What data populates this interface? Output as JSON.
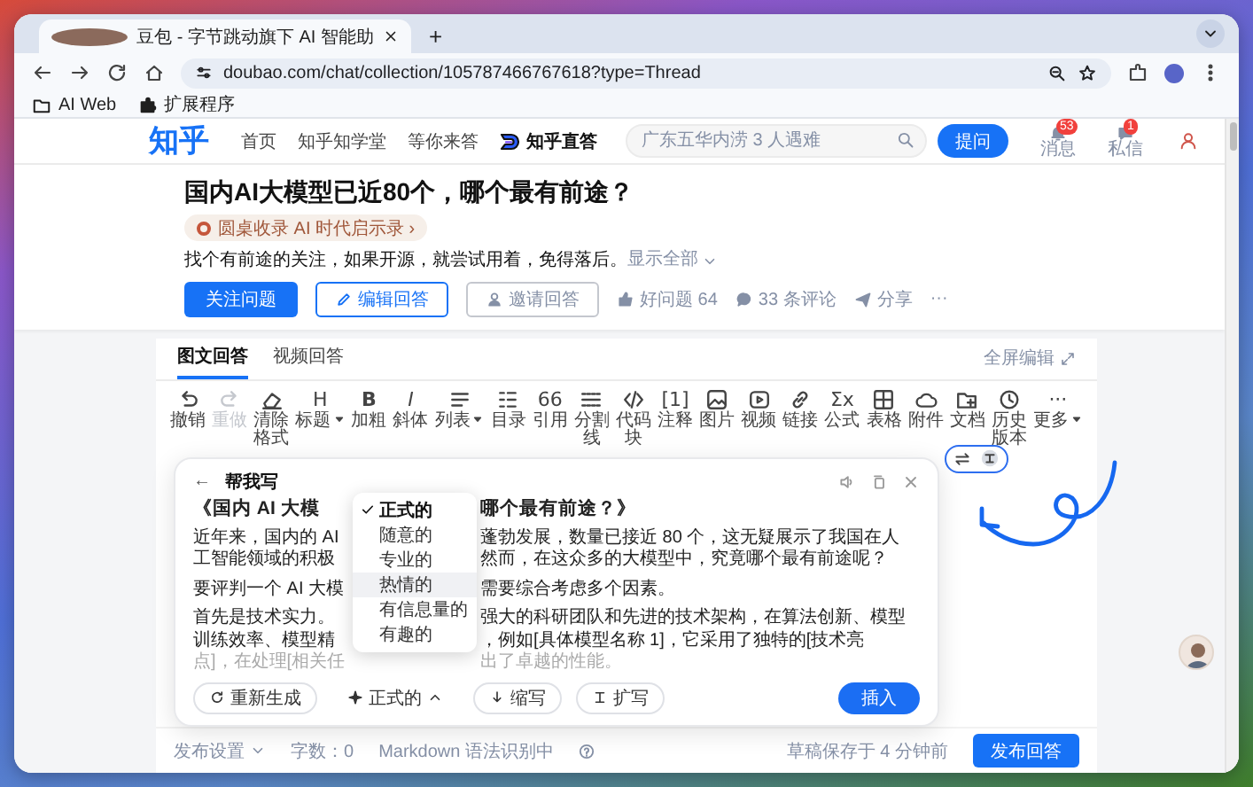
{
  "browser": {
    "tab": {
      "title": "豆包 - 字节跳动旗下 AI 智能助"
    },
    "new_tab": "+",
    "url": "doubao.com/chat/collection/105787466767618?type=Thread",
    "bookmarks": [
      {
        "label": "AI Web",
        "kind": "folder"
      },
      {
        "label": "扩展程序",
        "kind": "puzzle"
      }
    ]
  },
  "header": {
    "logo": "知乎",
    "nav": [
      {
        "label": "首页",
        "kind": "link"
      },
      {
        "label": "知乎知学堂",
        "kind": "link"
      },
      {
        "label": "等你来答",
        "kind": "link"
      },
      {
        "label": "知乎直答",
        "kind": "brand"
      }
    ],
    "search": {
      "placeholder": "广东五华内涝 3 人遇难"
    },
    "ask_button": "提问",
    "icons": [
      {
        "label": "消息",
        "badge": "53",
        "kind": "bell"
      },
      {
        "label": "私信",
        "badge": "1",
        "kind": "mail"
      }
    ]
  },
  "question": {
    "title": "国内AI大模型已近80个，哪个最有前途？",
    "tag": "圆桌收录 AI 时代启示录",
    "tag_arrow": "›",
    "description": "找个有前途的关注，如果开源，就尝试用着，免得落后。",
    "show_all": "显示全部",
    "actions": [
      {
        "label": "关注问题",
        "kind": "primary"
      },
      {
        "label": "编辑回答",
        "kind": "edit"
      },
      {
        "label": "邀请回答",
        "kind": "invite"
      },
      {
        "label": "好问题 64",
        "kind": "vote"
      },
      {
        "label": "33 条评论",
        "kind": "comment"
      },
      {
        "label": "分享",
        "kind": "share"
      },
      {
        "label": "···",
        "kind": "more"
      }
    ]
  },
  "editor": {
    "tabs": [
      {
        "label": "图文回答",
        "selected": true
      },
      {
        "label": "视频回答",
        "selected": false
      }
    ],
    "fullscreen": "全屏编辑",
    "toolbar": [
      {
        "kind": "undo",
        "label": "撤销",
        "disabled": false,
        "dropdown": false
      },
      {
        "kind": "redo",
        "label": "重做",
        "disabled": true,
        "dropdown": false
      },
      {
        "kind": "eraser",
        "label": "清除格式",
        "disabled": false,
        "dropdown": false
      },
      {
        "kind": "glyph",
        "glyph": "H",
        "label": "标题",
        "disabled": false,
        "dropdown": true
      },
      {
        "kind": "glyph",
        "glyph": "B",
        "label": "加粗",
        "disabled": false,
        "dropdown": false
      },
      {
        "kind": "glyph",
        "glyph": "I",
        "label": "斜体",
        "disabled": false,
        "dropdown": false
      },
      {
        "kind": "list",
        "label": "列表",
        "disabled": false,
        "dropdown": true
      },
      {
        "kind": "toc",
        "label": "目录",
        "disabled": false,
        "dropdown": false
      },
      {
        "kind": "glyph",
        "glyph": "66",
        "label": "引用",
        "disabled": false,
        "dropdown": false
      },
      {
        "kind": "divider",
        "label": "分割线",
        "disabled": false,
        "dropdown": false
      },
      {
        "kind": "code",
        "label": "代码块",
        "disabled": false,
        "dropdown": false
      },
      {
        "kind": "glyph",
        "glyph": "[1]",
        "label": "注释",
        "disabled": false,
        "dropdown": false
      },
      {
        "kind": "image",
        "label": "图片",
        "disabled": false,
        "dropdown": false
      },
      {
        "kind": "video",
        "label": "视频",
        "disabled": false,
        "dropdown": false
      },
      {
        "kind": "link",
        "label": "链接",
        "disabled": false,
        "dropdown": false
      },
      {
        "kind": "glyph",
        "glyph": "Σx",
        "label": "公式",
        "disabled": false,
        "dropdown": false
      },
      {
        "kind": "table",
        "label": "表格",
        "disabled": false,
        "dropdown": false
      },
      {
        "kind": "cloud",
        "label": "附件",
        "disabled": false,
        "dropdown": false
      },
      {
        "kind": "folder",
        "label": "文档",
        "disabled": false,
        "dropdown": false
      },
      {
        "kind": "clock",
        "label": "历史版本",
        "disabled": false,
        "dropdown": false
      },
      {
        "kind": "glyph",
        "glyph": "···",
        "label": "更多",
        "disabled": false,
        "dropdown": true
      }
    ],
    "writer": {
      "back": "←",
      "title": "帮我写",
      "heading": {
        "left": "《国内 AI 大模",
        "right": "哪个最有前途？》"
      },
      "paragraphs": [
        {
          "lines": [
            {
              "left": "近年来，国内的 AI",
              "right": "蓬勃发展，数量已接近 80 个，这无疑展示了我国在人"
            },
            {
              "left": "工智能领域的积极",
              "right": "然而，在这众多的大模型中，究竟哪个最有前途呢？"
            }
          ]
        },
        {
          "lines": [
            {
              "left": "要评判一个 AI 大模",
              "right": "需要综合考虑多个因素。"
            }
          ]
        },
        {
          "lines": [
            {
              "left": "首先是技术实力。",
              "right": "强大的科研团队和先进的技术架构，在算法创新、模型"
            },
            {
              "left": "训练效率、模型精",
              "right": "，例如[具体模型名称 1]，它采用了独特的[技术亮"
            },
            {
              "left": "点]，在处理[相关任",
              "right": "出了卓越的性能。"
            }
          ]
        }
      ],
      "tone_menu": [
        {
          "label": "正式的",
          "selected": true,
          "highlighted": false
        },
        {
          "label": "随意的",
          "selected": false,
          "highlighted": false
        },
        {
          "label": "专业的",
          "selected": false,
          "highlighted": false
        },
        {
          "label": "热情的",
          "selected": false,
          "highlighted": true
        },
        {
          "label": "有信息量的",
          "selected": false,
          "highlighted": false
        },
        {
          "label": "有趣的",
          "selected": false,
          "highlighted": false
        }
      ],
      "actions": [
        {
          "kind": "regenerate",
          "label": "重新生成"
        },
        {
          "kind": "tone",
          "label": "正式的"
        },
        {
          "kind": "shorten",
          "label": "缩写"
        },
        {
          "kind": "expand",
          "label": "扩写"
        }
      ],
      "insert": "插入"
    },
    "footer": {
      "publish_settings": "发布设置",
      "word_count": "字数：0",
      "markdown": "Markdown 语法识别中",
      "draft": "草稿保存于 4 分钟前",
      "publish": "发布回答"
    }
  }
}
